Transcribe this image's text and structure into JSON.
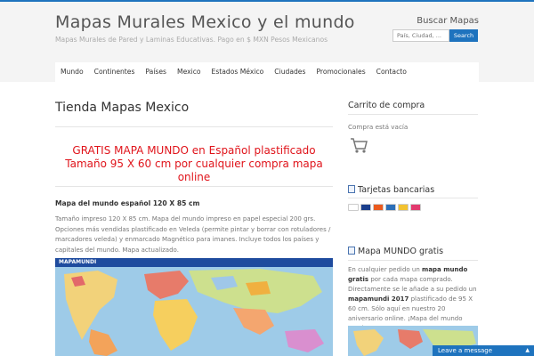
{
  "header": {
    "site_title": "Mapas Murales Mexico y el mundo",
    "tagline": "Mapas Murales de Pared y Laminas Educativas. Pago en $ MXN Pesos Mexicanos"
  },
  "search": {
    "title": "Buscar Mapas",
    "placeholder": "País, Ciudad, ...",
    "button_label": "Search"
  },
  "nav": {
    "items": [
      "Mundo",
      "Continentes",
      "Países",
      "Mexico",
      "Estados México",
      "Ciudades",
      "Promocionales",
      "Contacto"
    ]
  },
  "main": {
    "title": "Tienda Mapas Mexico",
    "promo_line1": "GRATIS MAPA MUNDO en Español plastificado",
    "promo_line2": "Tamaño 95 X 60 cm por cualquier compra mapa online",
    "product_heading": "Mapa del mundo español 120 X 85 cm",
    "product_description": "Tamaño impreso 120 X 85 cm. Mapa del mundo impreso en papel especial 200 grs. Opciones más vendidas plastificado en Veleda (permite pintar y borrar con rotuladores / marcadores veleda) y enmarcado Magnético para imanes. Incluye todos los países y capitales del mundo. Mapa actualizado.",
    "map_label": "MAPAMUNDI"
  },
  "sidebar": {
    "cart_title": "Carrito de compra",
    "cart_empty": "Compra está vacía",
    "cards_title": "Tarjetas bancarias",
    "free_title": "Mapa MUNDO gratis",
    "free_text_1": "En cualquier pedido un ",
    "free_text_bold_1": "mapa mundo gratis",
    "free_text_2": " por cada mapa comprado. Directamente se le añade a su pedido un ",
    "free_text_bold_2": "mapamundi 2017",
    "free_text_3": " plastificado de 95 X 60 cm. Sólo aquí en nuestro 20 aniversario online. ¡Mapa del mundo Gratis!"
  },
  "chat": {
    "label": "Leave a message"
  },
  "icons": [
    "cart-icon",
    "credit-card-icon",
    "image-icon",
    "chevron-up-icon"
  ],
  "colors": {
    "accent": "#1e73be",
    "promo_red": "#e0141b"
  }
}
